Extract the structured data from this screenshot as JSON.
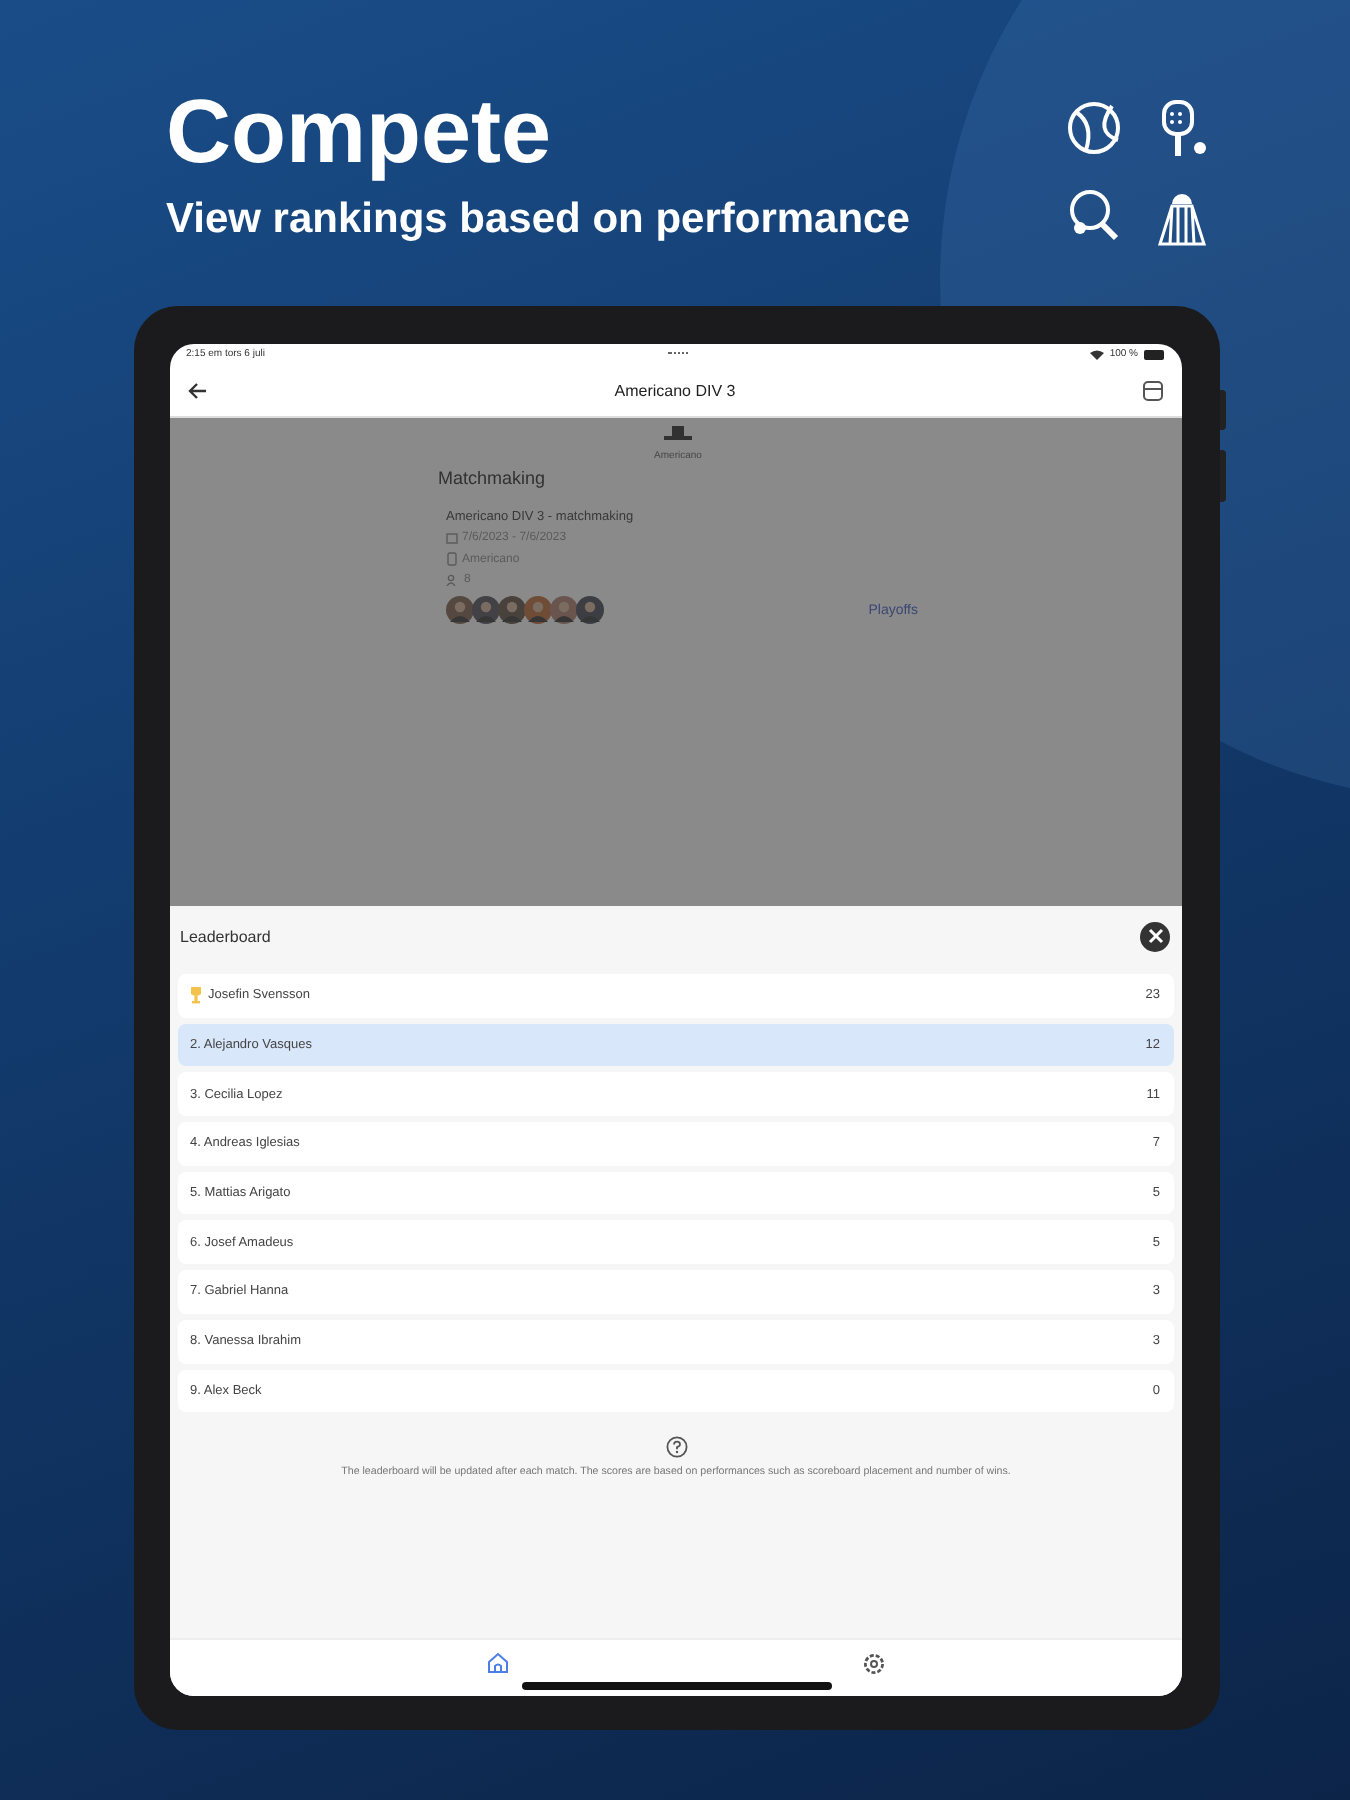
{
  "hero": {
    "title": "Compete",
    "subtitle": "View rankings based on performance"
  },
  "status_bar": {
    "time": "2:15 em  tors 6 juli",
    "battery": "100 %"
  },
  "app_bar": {
    "title": "Americano DIV 3"
  },
  "background_page": {
    "format_label": "Americano",
    "section_title": "Matchmaking",
    "event": {
      "title": "Americano DIV 3 - matchmaking",
      "dates": "7/6/2023 - 7/6/2023",
      "format": "Americano",
      "players": "8",
      "link": "Playoffs"
    }
  },
  "leaderboard": {
    "title": "Leaderboard",
    "rows": [
      {
        "kind": "winner",
        "name": "Josefin Svensson",
        "points": "23",
        "selected": false
      },
      {
        "kind": "ranked",
        "name": "2. Alejandro Vasques",
        "points": "12",
        "selected": true
      },
      {
        "kind": "ranked",
        "name": "3. Cecilia Lopez",
        "points": "11",
        "selected": false
      },
      {
        "kind": "ranked",
        "name": "4. Andreas Iglesias",
        "points": "7",
        "selected": false
      },
      {
        "kind": "ranked",
        "name": "5. Mattias Arigato",
        "points": "5",
        "selected": false
      },
      {
        "kind": "ranked",
        "name": "6. Josef Amadeus",
        "points": "5",
        "selected": false
      },
      {
        "kind": "ranked",
        "name": "7. Gabriel Hanna",
        "points": "3",
        "selected": false
      },
      {
        "kind": "ranked",
        "name": "8. Vanessa Ibrahim",
        "points": "3",
        "selected": false
      },
      {
        "kind": "ranked",
        "name": "9. Alex Beck",
        "points": "0",
        "selected": false
      }
    ],
    "note": "The leaderboard will be updated after each match. The scores are based on performances such as scoreboard placement and number of wins."
  },
  "bottom_nav": [
    {
      "kind": "home",
      "selected": true
    },
    {
      "kind": "settings",
      "selected": false
    }
  ]
}
